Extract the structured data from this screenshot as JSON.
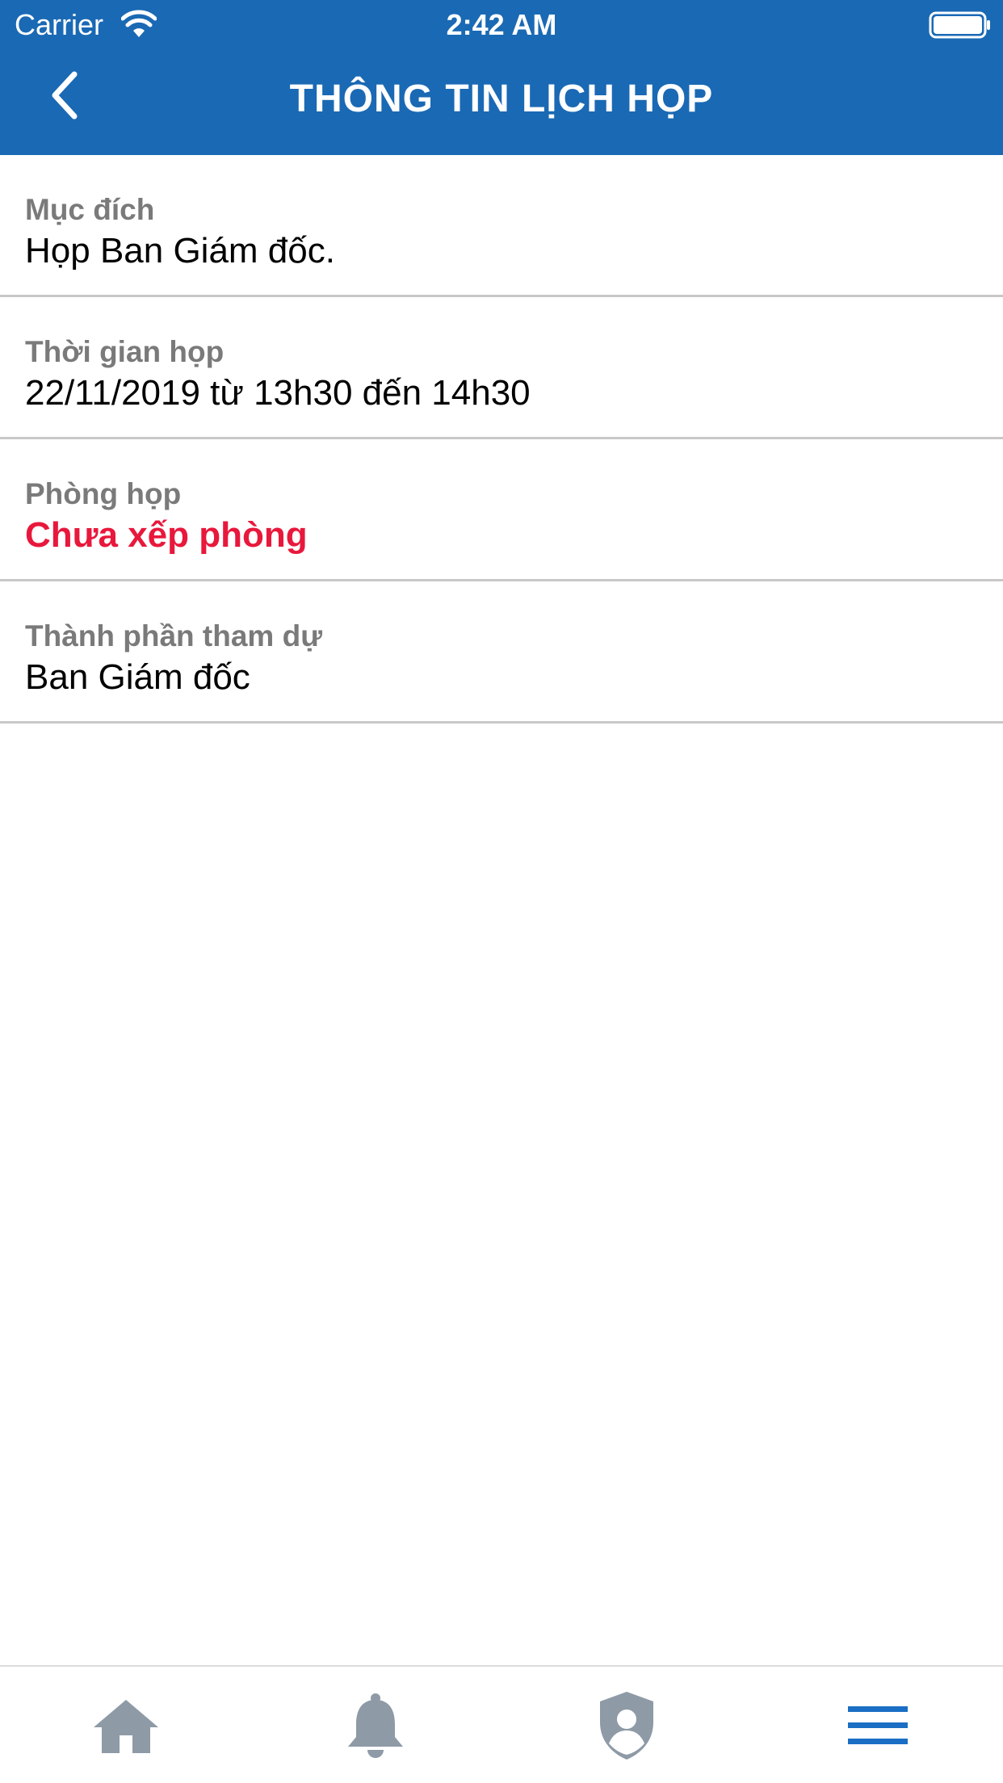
{
  "status_bar": {
    "carrier": "Carrier",
    "time": "2:42 AM"
  },
  "header": {
    "title": "THÔNG TIN LỊCH HỌP",
    "back_icon": "chevron-left-icon"
  },
  "details": [
    {
      "label": "Mục đích",
      "value": "Họp Ban Giám đốc."
    },
    {
      "label": "Thời gian họp",
      "value": "22/11/2019 từ 13h30 đến 14h30"
    },
    {
      "label": "Phòng họp",
      "value": "Chưa xếp phòng"
    },
    {
      "label": "Thành phần tham dự",
      "value": "Ban Giám đốc"
    }
  ],
  "tabbar": {
    "items": [
      {
        "icon": "home-icon",
        "active": false
      },
      {
        "icon": "bell-icon",
        "active": false
      },
      {
        "icon": "user-shield-icon",
        "active": false
      },
      {
        "icon": "menu-icon",
        "active": true
      }
    ]
  },
  "colors": {
    "header_bg": "#1a69b4",
    "label": "#7a7a7a",
    "value": "#000000",
    "alert": "#e8183c",
    "tab_inactive": "#8e9aa6",
    "tab_active": "#1a6fc4"
  }
}
